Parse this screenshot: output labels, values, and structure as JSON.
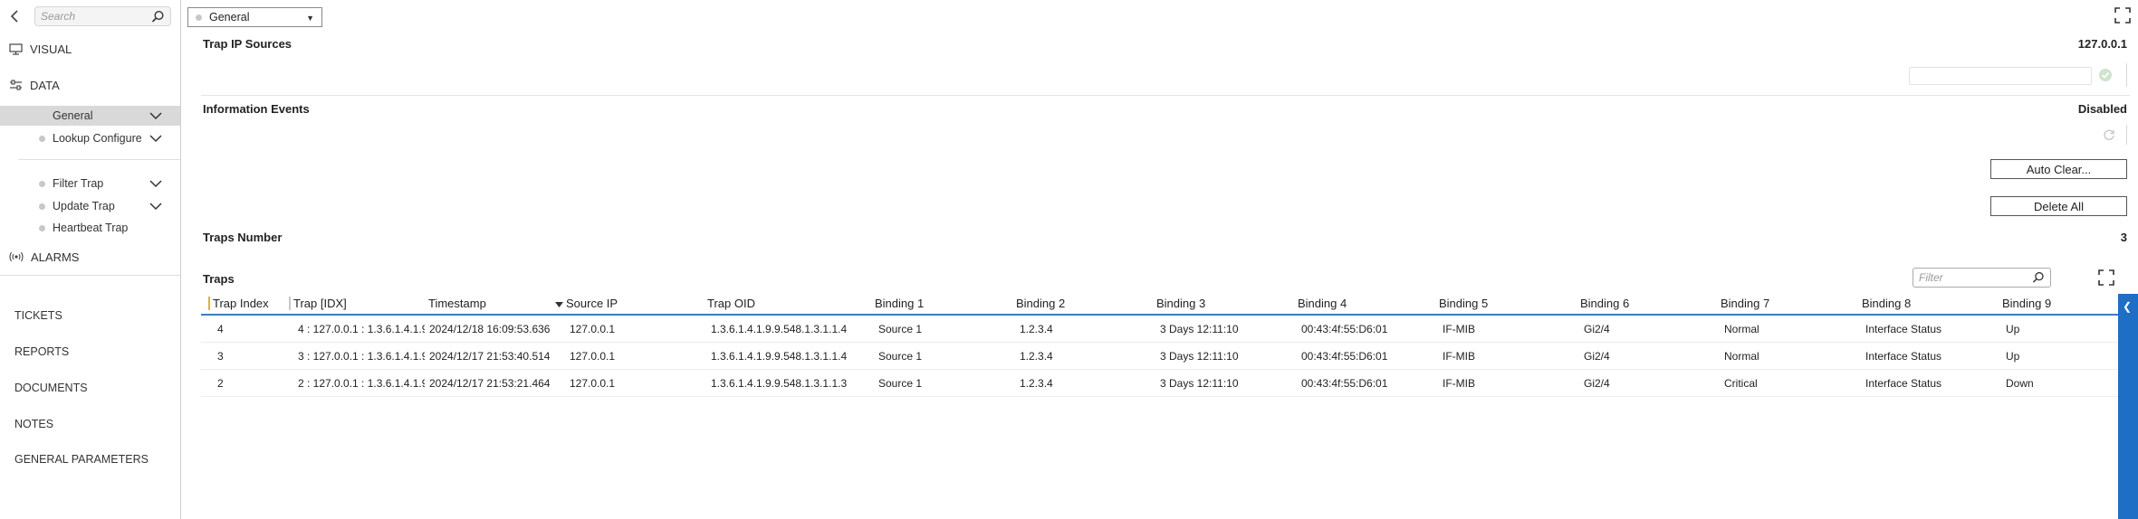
{
  "sidebar": {
    "search_placeholder": "Search",
    "visual_label": "VISUAL",
    "data_label": "DATA",
    "items": [
      {
        "label": "General"
      },
      {
        "label": "Lookup Configure"
      },
      {
        "label": "Filter Trap"
      },
      {
        "label": "Update Trap"
      },
      {
        "label": "Heartbeat Trap"
      }
    ],
    "alarms_label": "ALARMS",
    "links": [
      "TICKETS",
      "REPORTS",
      "DOCUMENTS",
      "NOTES",
      "GENERAL PARAMETERS"
    ]
  },
  "toolbar": {
    "selected": "General"
  },
  "sections": {
    "trap_ip": {
      "title": "Trap IP Sources",
      "value": "127.0.0.1"
    },
    "info_events": {
      "title": "Information Events",
      "value": "Disabled"
    },
    "auto_clear_label": "Auto Clear...",
    "delete_all_label": "Delete All",
    "traps_number": {
      "title": "Traps Number",
      "value": "3"
    },
    "traps_title": "Traps",
    "filter_placeholder": "Filter"
  },
  "table": {
    "columns": [
      "Trap Index",
      "Trap [IDX]",
      "Timestamp",
      "Source IP",
      "Trap OID",
      "Binding 1",
      "Binding 2",
      "Binding 3",
      "Binding 4",
      "Binding 5",
      "Binding 6",
      "Binding 7",
      "Binding 8",
      "Binding 9"
    ],
    "rows": [
      [
        "4",
        "4 : 127.0.0.1 : 1.3.6.1.4.1.9...",
        "2024/12/18 16:09:53.636",
        "127.0.0.1",
        "1.3.6.1.4.1.9.9.548.1.3.1.1.4",
        "Source 1",
        "1.2.3.4",
        "3 Days 12:11:10",
        "00:43:4f:55:D6:01",
        "IF-MIB",
        "Gi2/4",
        "Normal",
        "Interface Status",
        "Up"
      ],
      [
        "3",
        "3 : 127.0.0.1 : 1.3.6.1.4.1.9...",
        "2024/12/17 21:53:40.514",
        "127.0.0.1",
        "1.3.6.1.4.1.9.9.548.1.3.1.1.4",
        "Source 1",
        "1.2.3.4",
        "3 Days 12:11:10",
        "00:43:4f:55:D6:01",
        "IF-MIB",
        "Gi2/4",
        "Normal",
        "Interface Status",
        "Up"
      ],
      [
        "2",
        "2 : 127.0.0.1 : 1.3.6.1.4.1.9...",
        "2024/12/17 21:53:21.464",
        "127.0.0.1",
        "1.3.6.1.4.1.9.9.548.1.3.1.1.3",
        "Source 1",
        "1.2.3.4",
        "3 Days 12:11:10",
        "00:43:4f:55:D6:01",
        "IF-MIB",
        "Gi2/4",
        "Critical",
        "Interface Status",
        "Down"
      ]
    ]
  },
  "colors": {
    "accent": "#3d7ec0",
    "strip": "#1d6ec4",
    "active_item_bg": "#d9d9d9"
  }
}
